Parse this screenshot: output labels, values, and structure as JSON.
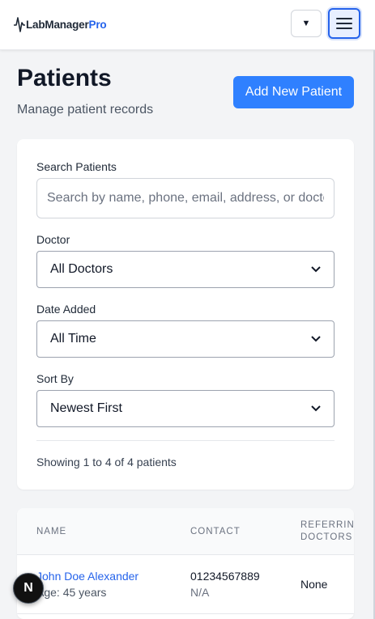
{
  "header": {
    "brand_main": "LabManager",
    "brand_accent": "Pro",
    "dropdown_glyph": "▼",
    "menu_icon": "hamburger-icon"
  },
  "page": {
    "title": "Patients",
    "subtitle": "Manage patient records",
    "add_button_label": "Add New Patient"
  },
  "filters": {
    "search_label": "Search Patients",
    "search_placeholder": "Search by name, phone, email, address, or doctor",
    "search_value": "",
    "doctor_label": "Doctor",
    "doctor_selected": "All Doctors",
    "date_label": "Date Added",
    "date_selected": "All Time",
    "sort_label": "Sort By",
    "sort_selected": "Newest First",
    "showing_text": "Showing 1 to 4 of 4 patients"
  },
  "table": {
    "columns": [
      "Name",
      "Contact",
      "Referring Doctors"
    ],
    "rows": [
      {
        "name": "John Doe Alexander",
        "age": "Age: 45 years",
        "phone": "01234567889",
        "email": "N/A",
        "referring_doctors": "None"
      }
    ]
  },
  "fab": {
    "label": "N"
  },
  "colors": {
    "primary": "#2f80ff",
    "link": "#2563eb",
    "background": "#f3f4f6"
  }
}
